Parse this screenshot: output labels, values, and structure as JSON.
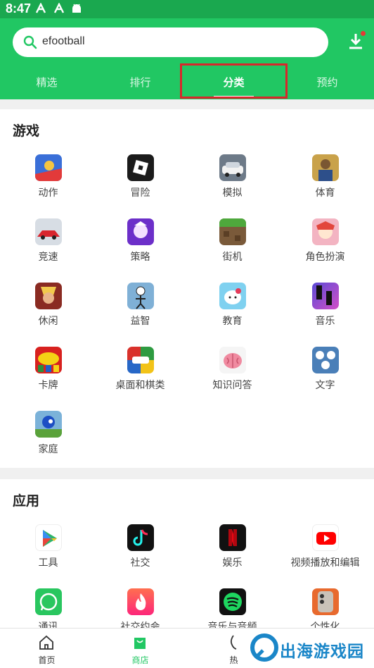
{
  "status_bar": {
    "time": "8:47"
  },
  "search": {
    "value": "efootball"
  },
  "tabs": [
    {
      "label": "精选"
    },
    {
      "label": "排行"
    },
    {
      "label": "分类"
    },
    {
      "label": "预约"
    }
  ],
  "active_tab": "分类",
  "games_section": {
    "title": "游戏",
    "items": [
      {
        "label": "动作",
        "icon": "action-game-icon"
      },
      {
        "label": "冒险",
        "icon": "roblox-icon"
      },
      {
        "label": "模拟",
        "icon": "car-sim-icon"
      },
      {
        "label": "体育",
        "icon": "football-icon"
      },
      {
        "label": "竞速",
        "icon": "racing-car-icon"
      },
      {
        "label": "策略",
        "icon": "strategy-icon"
      },
      {
        "label": "街机",
        "icon": "minecraft-icon"
      },
      {
        "label": "角色扮演",
        "icon": "rpg-icon"
      },
      {
        "label": "休闲",
        "icon": "fighter-icon"
      },
      {
        "label": "益智",
        "icon": "stickman-icon"
      },
      {
        "label": "教育",
        "icon": "hello-kitty-icon"
      },
      {
        "label": "音乐",
        "icon": "piano-tiles-icon"
      },
      {
        "label": "卡牌",
        "icon": "uno-icon"
      },
      {
        "label": "桌面和棋类",
        "icon": "ludo-king-icon"
      },
      {
        "label": "知识问答",
        "icon": "brain-test-icon"
      },
      {
        "label": "文字",
        "icon": "wow-words-icon"
      },
      {
        "label": "家庭",
        "icon": "sonic-icon"
      }
    ]
  },
  "apps_section": {
    "title": "应用",
    "items": [
      {
        "label": "工具",
        "icon": "google-play-icon"
      },
      {
        "label": "社交",
        "icon": "tiktok-icon"
      },
      {
        "label": "娱乐",
        "icon": "netflix-icon"
      },
      {
        "label": "视频播放和编辑",
        "icon": "youtube-icon"
      },
      {
        "label": "通讯",
        "icon": "whatsapp-icon"
      },
      {
        "label": "社交约会",
        "icon": "tinder-icon"
      },
      {
        "label": "音乐与音频",
        "icon": "spotify-icon"
      },
      {
        "label": "个性化",
        "icon": "iphone-wallpaper-icon"
      }
    ]
  },
  "bottom_nav": [
    {
      "label": "首页",
      "icon": "home-icon"
    },
    {
      "label": "商店",
      "icon": "store-bag-icon"
    },
    {
      "label": "热",
      "icon": "hot-icon"
    }
  ],
  "watermark": {
    "text": "出海游戏园"
  },
  "colors": {
    "brand_green": "#21c763",
    "status_green": "#1aa84f",
    "highlight_red": "#d9262b"
  }
}
